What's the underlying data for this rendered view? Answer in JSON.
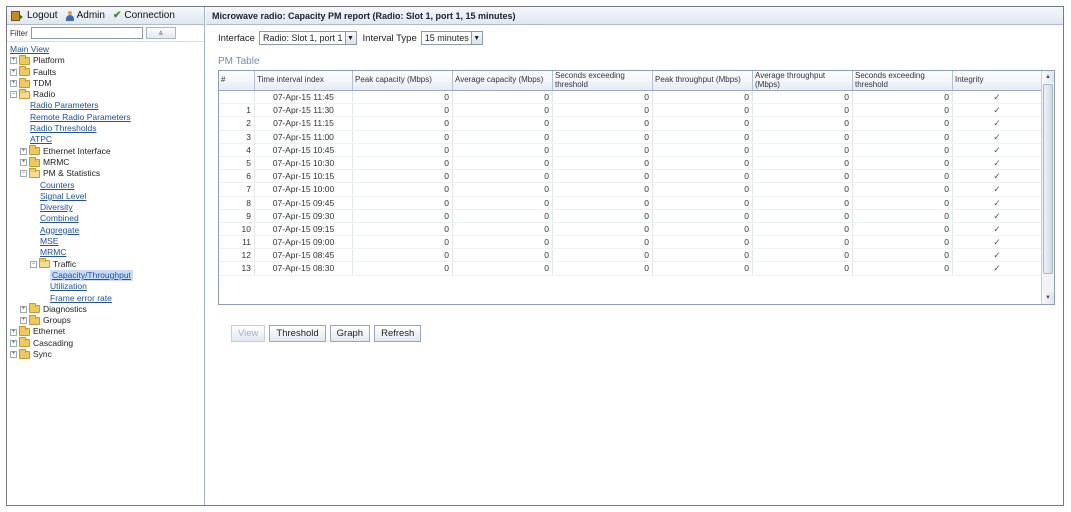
{
  "toolbar": {
    "logout": "Logout",
    "admin": "Admin",
    "connection": "Connection"
  },
  "filter": {
    "label": "Filter",
    "value": "",
    "button": "⩓"
  },
  "tree": [
    {
      "label": "Main View",
      "depth": 0,
      "type": "link"
    },
    {
      "label": "Platform",
      "depth": 0,
      "type": "folder",
      "exp": "+"
    },
    {
      "label": "Faults",
      "depth": 0,
      "type": "folder",
      "exp": "+"
    },
    {
      "label": "TDM",
      "depth": 0,
      "type": "folder",
      "exp": "+"
    },
    {
      "label": "Radio",
      "depth": 0,
      "type": "folder",
      "exp": "−",
      "open": true
    },
    {
      "label": "Radio Parameters",
      "depth": 2,
      "type": "link"
    },
    {
      "label": "Remote Radio Parameters",
      "depth": 2,
      "type": "link"
    },
    {
      "label": "Radio Thresholds",
      "depth": 2,
      "type": "link"
    },
    {
      "label": "ATPC",
      "depth": 2,
      "type": "link"
    },
    {
      "label": "Ethernet Interface",
      "depth": 1,
      "type": "folder",
      "exp": "+"
    },
    {
      "label": "MRMC",
      "depth": 1,
      "type": "folder",
      "exp": "+"
    },
    {
      "label": "PM & Statistics",
      "depth": 1,
      "type": "folder",
      "exp": "−",
      "open": true
    },
    {
      "label": "Counters",
      "depth": 3,
      "type": "link"
    },
    {
      "label": "Signal Level",
      "depth": 3,
      "type": "link"
    },
    {
      "label": "Diversity",
      "depth": 3,
      "type": "link"
    },
    {
      "label": "Combined",
      "depth": 3,
      "type": "link"
    },
    {
      "label": "Aggregate",
      "depth": 3,
      "type": "link"
    },
    {
      "label": "MSE",
      "depth": 3,
      "type": "link"
    },
    {
      "label": "MRMC",
      "depth": 3,
      "type": "link"
    },
    {
      "label": "Traffic",
      "depth": 2,
      "type": "folder",
      "exp": "−",
      "open": true
    },
    {
      "label": "Capacity/Throughput",
      "depth": 4,
      "type": "link",
      "selected": true
    },
    {
      "label": "Utilization",
      "depth": 4,
      "type": "link"
    },
    {
      "label": "Frame error rate",
      "depth": 4,
      "type": "link"
    },
    {
      "label": "Diagnostics",
      "depth": 1,
      "type": "folder",
      "exp": "+"
    },
    {
      "label": "Groups",
      "depth": 1,
      "type": "folder",
      "exp": "+"
    },
    {
      "label": "Ethernet",
      "depth": 0,
      "type": "folder",
      "exp": "+"
    },
    {
      "label": "Cascading",
      "depth": 0,
      "type": "folder",
      "exp": "+"
    },
    {
      "label": "Sync",
      "depth": 0,
      "type": "folder",
      "exp": "+"
    }
  ],
  "main": {
    "title": "Microwave radio: Capacity PM report (Radio: Slot 1, port 1, 15 minutes)",
    "interface_label": "Interface",
    "interface_value": "Radio: Slot 1, port 1",
    "interval_label": "Interval Type",
    "interval_value": "15 minutes",
    "table_title": "PM Table",
    "columns": [
      "#",
      "Time interval index",
      "Peak capacity (Mbps)",
      "Average capacity (Mbps)",
      "Seconds exceeding threshold",
      "Peak throughput (Mbps)",
      "Average throughput (Mbps)",
      "Seconds exceeding threshold",
      "Integrity"
    ],
    "rows": [
      [
        "",
        "07-Apr-15 11:45",
        "0",
        "0",
        "0",
        "0",
        "0",
        "0",
        "✓"
      ],
      [
        "1",
        "07-Apr-15 11:30",
        "0",
        "0",
        "0",
        "0",
        "0",
        "0",
        "✓"
      ],
      [
        "2",
        "07-Apr-15 11:15",
        "0",
        "0",
        "0",
        "0",
        "0",
        "0",
        "✓"
      ],
      [
        "3",
        "07-Apr-15 11:00",
        "0",
        "0",
        "0",
        "0",
        "0",
        "0",
        "✓"
      ],
      [
        "4",
        "07-Apr-15 10:45",
        "0",
        "0",
        "0",
        "0",
        "0",
        "0",
        "✓"
      ],
      [
        "5",
        "07-Apr-15 10:30",
        "0",
        "0",
        "0",
        "0",
        "0",
        "0",
        "✓"
      ],
      [
        "6",
        "07-Apr-15 10:15",
        "0",
        "0",
        "0",
        "0",
        "0",
        "0",
        "✓"
      ],
      [
        "7",
        "07-Apr-15 10:00",
        "0",
        "0",
        "0",
        "0",
        "0",
        "0",
        "✓"
      ],
      [
        "8",
        "07-Apr-15 09:45",
        "0",
        "0",
        "0",
        "0",
        "0",
        "0",
        "✓"
      ],
      [
        "9",
        "07-Apr-15 09:30",
        "0",
        "0",
        "0",
        "0",
        "0",
        "0",
        "✓"
      ],
      [
        "10",
        "07-Apr-15 09:15",
        "0",
        "0",
        "0",
        "0",
        "0",
        "0",
        "✓"
      ],
      [
        "11",
        "07-Apr-15 09:00",
        "0",
        "0",
        "0",
        "0",
        "0",
        "0",
        "✓"
      ],
      [
        "12",
        "07-Apr-15 08:45",
        "0",
        "0",
        "0",
        "0",
        "0",
        "0",
        "✓"
      ],
      [
        "13",
        "07-Apr-15 08:30",
        "0",
        "0",
        "0",
        "0",
        "0",
        "0",
        "✓"
      ]
    ],
    "buttons": {
      "view": "View",
      "threshold": "Threshold",
      "graph": "Graph",
      "refresh": "Refresh"
    }
  }
}
